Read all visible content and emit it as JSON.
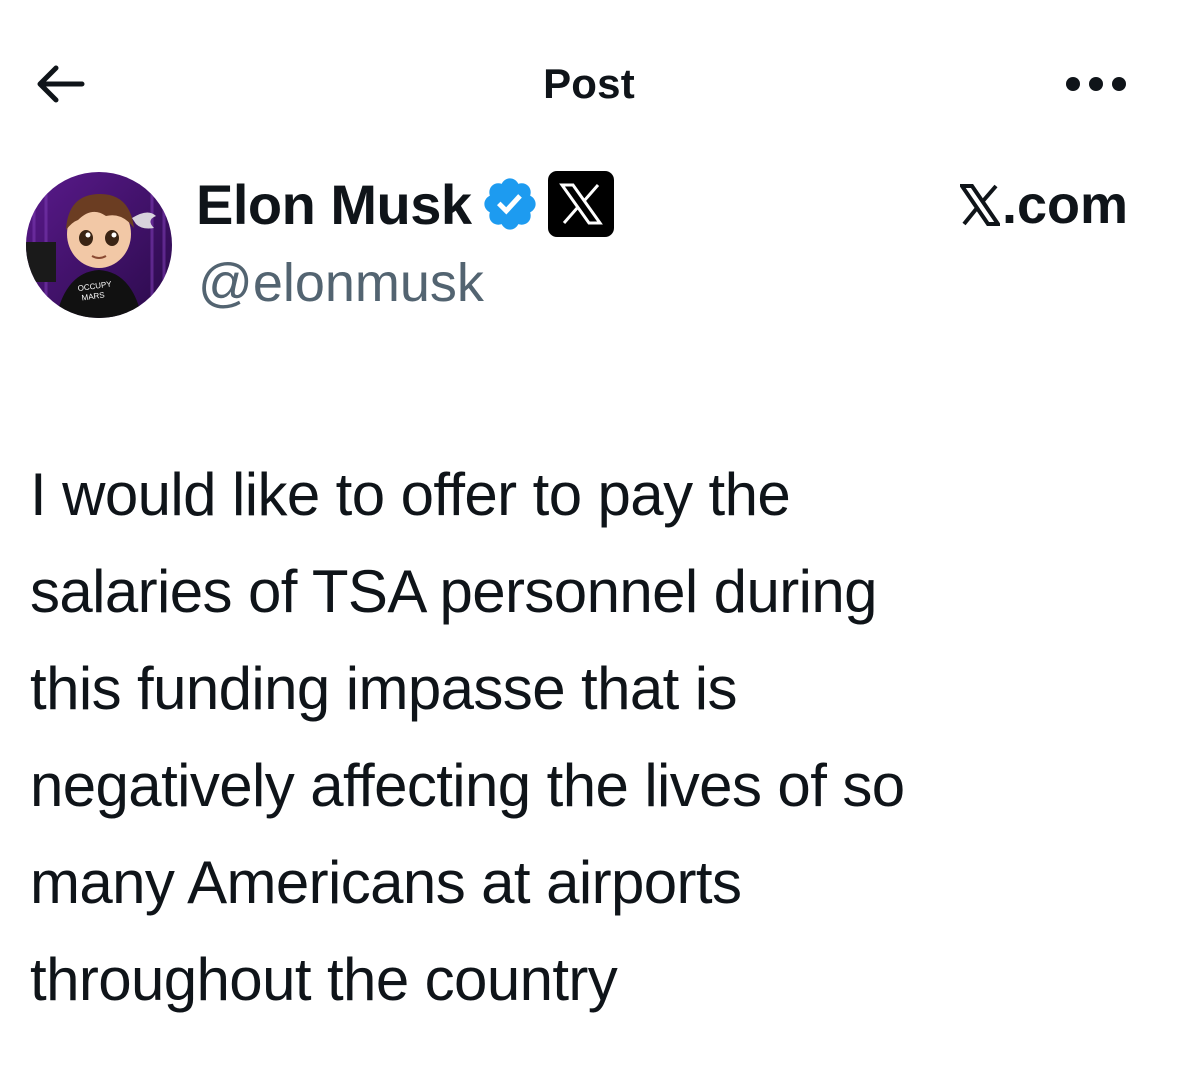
{
  "header": {
    "title": "Post",
    "back_icon": "arrow-left-icon",
    "more_icon": "more-horizontal-icon"
  },
  "author": {
    "display_name": "Elon Musk",
    "handle": "@elonmusk",
    "verified_icon": "verified-badge-icon",
    "affiliate_icon": "x-logo-icon",
    "avatar_text": "OCCUPY MARS"
  },
  "source": {
    "label": ".com",
    "logo_icon": "x-logo-icon"
  },
  "post": {
    "text": "I would like to offer to pay the\nsalaries of TSA personnel during\nthis funding impasse that is\nnegatively affecting the lives of so\nmany Americans at airports\nthroughout the country"
  },
  "colors": {
    "text_primary": "#0f1419",
    "text_secondary": "#536471",
    "verified_blue": "#1d9bf0",
    "badge_black": "#000000"
  }
}
